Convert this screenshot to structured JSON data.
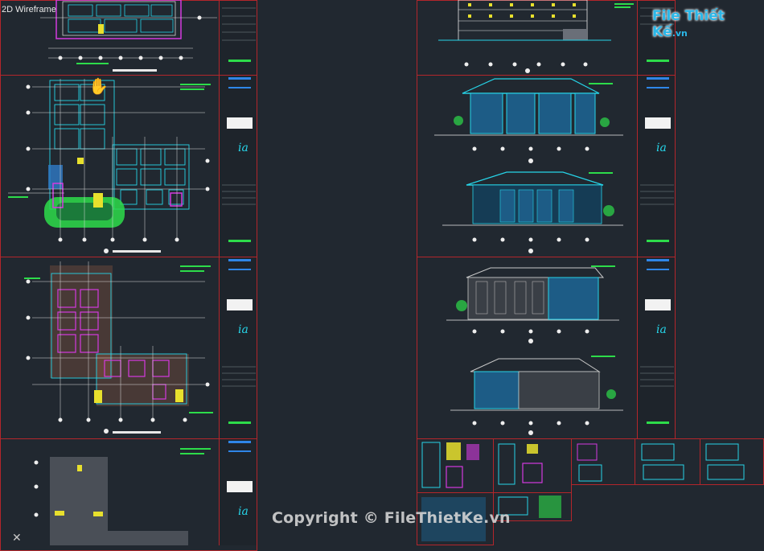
{
  "viewport": {
    "label": "2D Wireframe"
  },
  "watermark": {
    "text": "Copyright © FileThietKe.vn"
  },
  "logo": {
    "brand": "File Thiết Kế",
    "suffix": ".vn"
  },
  "icons": {
    "cursor": "hand-pan-icon",
    "ucs": "ucs-cross-icon"
  },
  "colors": {
    "background": "#212830",
    "sheet_border": "#b3262b",
    "cyan": "#26d4e8",
    "green": "#2ddc4a",
    "magenta": "#d43adf",
    "yellow": "#e8e02d"
  }
}
